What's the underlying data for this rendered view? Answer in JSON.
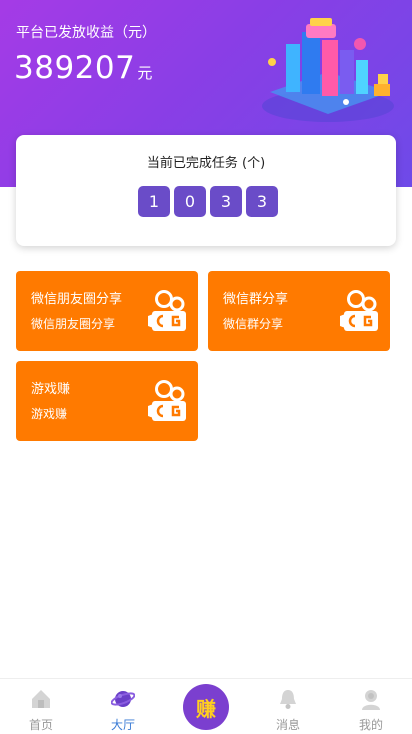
{
  "hero": {
    "label": "平台已发放收益（元）",
    "amount": "389207",
    "unit": "元"
  },
  "task_card": {
    "title": "当前已完成任务 (个)",
    "digits": [
      "1",
      "0",
      "3",
      "3"
    ]
  },
  "tiles": [
    {
      "title": "微信朋友圈分享",
      "subtitle": "微信朋友圈分享",
      "icon": "video-camera-icon"
    },
    {
      "title": "微信群分享",
      "subtitle": "微信群分享",
      "icon": "video-camera-icon"
    },
    {
      "title": "游戏赚",
      "subtitle": "游戏赚",
      "icon": "video-camera-icon"
    }
  ],
  "tabbar": {
    "items": [
      {
        "label": "首页",
        "icon": "home-icon",
        "active": false
      },
      {
        "label": "大厅",
        "icon": "planet-icon",
        "active": true
      },
      {
        "label": "",
        "icon": "earn-button",
        "active": false
      },
      {
        "label": "消息",
        "icon": "bell-icon",
        "active": false
      },
      {
        "label": "我的",
        "icon": "user-icon",
        "active": false
      }
    ],
    "earn_label": "赚"
  },
  "colors": {
    "hero_gradient_start": "#a53be6",
    "hero_gradient_end": "#6e4ae8",
    "digit_bg": "#6a4cc8",
    "tile_bg": "#ff7a00",
    "tab_active": "#3a7bd5",
    "earn_button_bg": "#7b3fcf",
    "earn_text": "#ffcf1f"
  }
}
